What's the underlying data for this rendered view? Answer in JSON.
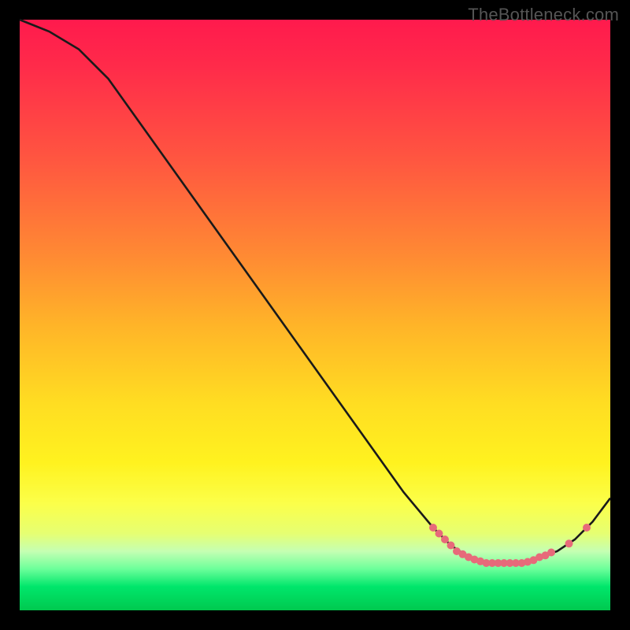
{
  "watermark": "TheBottleneck.com",
  "colors": {
    "bg": "#000000",
    "marker": "#e76a7a",
    "line": "#1a1a1a"
  },
  "chart_data": {
    "type": "line",
    "title": "",
    "xlabel": "",
    "ylabel": "",
    "xlim": [
      0,
      100
    ],
    "ylim": [
      0,
      100
    ],
    "grid": false,
    "legend": false,
    "series": [
      {
        "name": "bottleneck-curve",
        "x": [
          0,
          5,
          10,
          15,
          20,
          25,
          30,
          35,
          40,
          45,
          50,
          55,
          60,
          65,
          70,
          73,
          76,
          79,
          82,
          85,
          88,
          91,
          94,
          97,
          100
        ],
        "y": [
          100,
          98,
          95,
          90,
          83,
          76,
          69,
          62,
          55,
          48,
          41,
          34,
          27,
          20,
          14,
          11,
          9,
          8,
          8,
          8,
          9,
          10,
          12,
          15,
          19
        ]
      }
    ],
    "markers": {
      "name": "recommended-range",
      "x": [
        70,
        71,
        72,
        73,
        74,
        75,
        76,
        77,
        78,
        79,
        80,
        81,
        82,
        83,
        84,
        85,
        86,
        87,
        88,
        89,
        90,
        93,
        96
      ],
      "y": [
        14,
        13,
        12,
        11,
        10,
        9.5,
        9,
        8.6,
        8.3,
        8,
        8,
        8,
        8,
        8,
        8,
        8,
        8.2,
        8.5,
        9,
        9.3,
        9.8,
        11.3,
        14
      ]
    }
  }
}
